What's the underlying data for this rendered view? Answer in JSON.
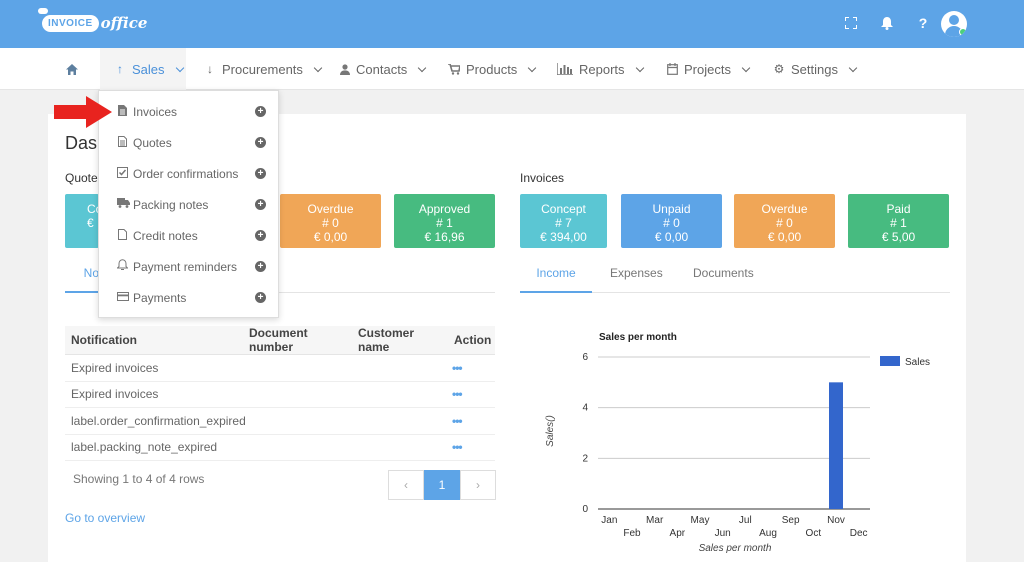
{
  "app": {
    "logo_pill": "INVOICE",
    "logo_script": "office"
  },
  "topbar": {
    "icons": [
      "fullscreen-icon",
      "bell-icon",
      "help-icon",
      "plus-icon"
    ],
    "help_glyph": "?",
    "plus_glyph": "+"
  },
  "nav": {
    "home_icon": "home-icon",
    "items": [
      {
        "label": "Sales",
        "icon": "arrow-up-icon"
      },
      {
        "label": "Procurements",
        "icon": "arrow-down-icon"
      },
      {
        "label": "Contacts",
        "icon": "user-icon"
      },
      {
        "label": "Products",
        "icon": "cart-icon"
      },
      {
        "label": "Reports",
        "icon": "bar-chart-icon"
      },
      {
        "label": "Projects",
        "icon": "calendar-icon"
      },
      {
        "label": "Settings",
        "icon": "gear-icon"
      }
    ]
  },
  "dropdown": {
    "items": [
      {
        "label": "Invoices",
        "icon": "file-icon"
      },
      {
        "label": "Quotes",
        "icon": "file-text-icon"
      },
      {
        "label": "Order confirmations",
        "icon": "check-square-icon"
      },
      {
        "label": "Packing notes",
        "icon": "truck-icon"
      },
      {
        "label": "Credit notes",
        "icon": "file-outline-icon"
      },
      {
        "label": "Payment reminders",
        "icon": "bell-outline-icon"
      },
      {
        "label": "Payments",
        "icon": "credit-card-icon"
      }
    ],
    "plus_glyph": "+"
  },
  "dashboard": {
    "title": "Dashboard",
    "title_visible": "Dasl"
  },
  "quotes": {
    "label": "Quotes",
    "tiles": [
      {
        "title": "Concept",
        "title_visible": "Co",
        "count": "",
        "amount": "€",
        "color": "#5bc6d3"
      },
      {
        "title": "Overdue",
        "count": "# 0",
        "amount": "€ 0,00",
        "color": "#f0a657"
      },
      {
        "title": "Approved",
        "count": "# 1",
        "amount": "€ 16,96",
        "color": "#47bb80"
      }
    ],
    "tab_visible": "No"
  },
  "invoices": {
    "label": "Invoices",
    "tiles": [
      {
        "title": "Concept",
        "count": "# 7",
        "amount": "€ 394,00",
        "color": "#5bc6d3"
      },
      {
        "title": "Unpaid",
        "count": "# 0",
        "amount": "€ 0,00",
        "color": "#5da4e7"
      },
      {
        "title": "Overdue",
        "count": "# 0",
        "amount": "€ 0,00",
        "color": "#f0a657"
      },
      {
        "title": "Paid",
        "count": "# 1",
        "amount": "€ 5,00",
        "color": "#47bb80"
      }
    ],
    "tabs": [
      "Income",
      "Expenses",
      "Documents"
    ]
  },
  "notifications": {
    "headers": [
      "Notification",
      "Document number",
      "Customer name",
      "Action"
    ],
    "rows": [
      [
        "Expired invoices",
        "",
        "",
        "•••"
      ],
      [
        "Expired invoices",
        "",
        "",
        "•••"
      ],
      [
        "label.order_confirmation_expired",
        "",
        "",
        "•••"
      ],
      [
        "label.packing_note_expired",
        "",
        "",
        "•••"
      ]
    ],
    "showing": "Showing 1 to 4 of 4 rows",
    "pager": {
      "prev": "‹",
      "current": "1",
      "next": "›"
    },
    "overview_link": "Go to overview"
  },
  "chart_data": {
    "type": "bar",
    "title": "Sales per month",
    "xlabel": "Sales per month",
    "ylabel": "Sales()",
    "categories": [
      "Jan",
      "Feb",
      "Mar",
      "Apr",
      "May",
      "Jun",
      "Jul",
      "Aug",
      "Sep",
      "Oct",
      "Nov",
      "Dec"
    ],
    "series": [
      {
        "name": "Sales",
        "values": [
          0,
          0,
          0,
          0,
          0,
          0,
          0,
          0,
          0,
          0,
          5,
          0
        ],
        "color": "#3366cc"
      }
    ],
    "ylim": [
      0,
      6
    ],
    "yticks": [
      0,
      2,
      4,
      6
    ],
    "grid": true,
    "legend": "right"
  }
}
